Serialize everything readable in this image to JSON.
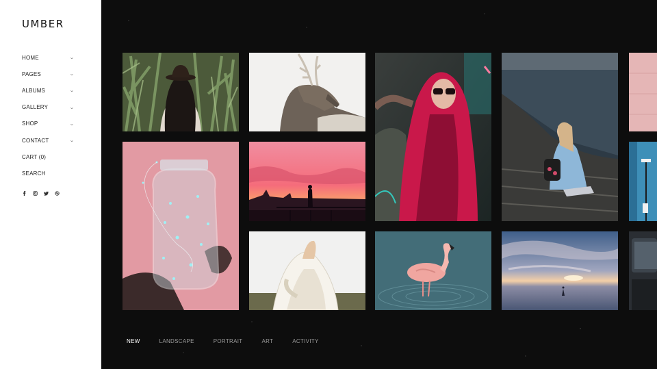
{
  "brand": {
    "logo": "UMBER"
  },
  "menu": {
    "items": [
      {
        "label": "HOME",
        "has_dropdown": true
      },
      {
        "label": "PAGES",
        "has_dropdown": true
      },
      {
        "label": "ALBUMS",
        "has_dropdown": true
      },
      {
        "label": "GALLERY",
        "has_dropdown": true
      },
      {
        "label": "SHOP",
        "has_dropdown": true
      },
      {
        "label": "CONTACT",
        "has_dropdown": true
      },
      {
        "label": "CART (0)",
        "has_dropdown": false
      },
      {
        "label": "SEARCH",
        "has_dropdown": false
      }
    ],
    "chevron": "⌄"
  },
  "socials": [
    "facebook-icon",
    "instagram-icon",
    "twitter-icon",
    "dribbble-icon"
  ],
  "gallery": {
    "tiles": [
      "woman-in-hat-cornfield",
      "deer-white-background",
      "woman-neon-pink-hair",
      "woman-sitting-cliff-sea",
      "pink-wall-partial",
      "hand-holding-fairy-light-jar",
      "sunset-silhouette-pier",
      "woman-veil-field",
      "flamingo-in-water",
      "sunset-sea-reflection",
      "street-blue-partial",
      "dark-vehicle-partial"
    ]
  },
  "filters": {
    "items": [
      "NEW",
      "LANDSCAPE",
      "PORTRAIT",
      "ART",
      "ACTIVITY"
    ],
    "active": "NEW"
  },
  "colors": {
    "sidebar_bg": "#ffffff",
    "main_bg": "#0d0d0d",
    "text_dark": "#222222",
    "filter_inactive": "#9a9a9a",
    "filter_active": "#ffffff"
  }
}
